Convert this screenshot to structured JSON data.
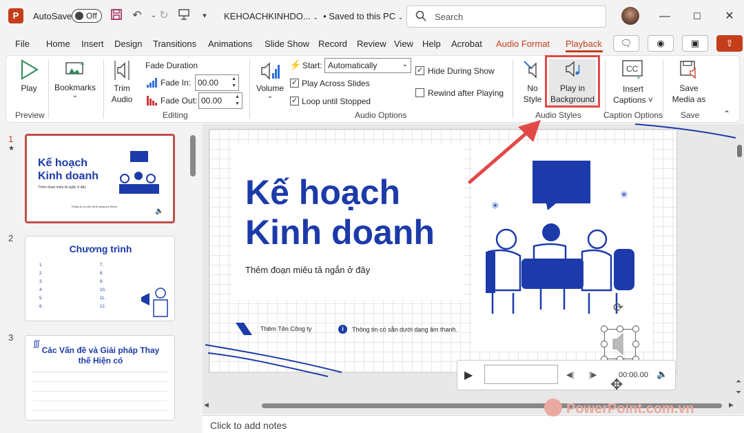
{
  "titlebar": {
    "app_badge": "P",
    "autosave_label": "AutoSave",
    "autosave_state": "Off",
    "filename": "KEHOACHKINHDO...",
    "save_status": "• Saved to this PC",
    "search_placeholder": "Search",
    "search_icon": "search-icon"
  },
  "menu": {
    "items": [
      "File",
      "Home",
      "Insert",
      "Design",
      "Transitions",
      "Animations",
      "Slide Show",
      "Record",
      "Review",
      "View",
      "Help",
      "Acrobat",
      "Audio Format",
      "Playback"
    ],
    "active": "Playback",
    "contextual": "Audio Format"
  },
  "ribbon": {
    "preview": {
      "play_label": "Play",
      "group": "Preview"
    },
    "bookmarks": {
      "label": "Bookmarks"
    },
    "editing": {
      "trim_line1": "Trim",
      "trim_line2": "Audio",
      "fade_duration": "Fade Duration",
      "fade_in_label": "Fade In:",
      "fade_in_value": "00.00",
      "fade_out_label": "Fade Out:",
      "fade_out_value": "00.00",
      "group": "Editing"
    },
    "audio_options": {
      "volume_label": "Volume",
      "start_label": "Start:",
      "start_value": "Automatically",
      "play_across_slides": "Play Across Slides",
      "play_across_checked": true,
      "loop_until_stopped": "Loop until Stopped",
      "loop_checked": true,
      "hide_during_show": "Hide During Show",
      "hide_checked": true,
      "rewind_after_playing": "Rewind after Playing",
      "rewind_checked": false,
      "group": "Audio Options"
    },
    "audio_styles": {
      "no_style_line1": "No",
      "no_style_line2": "Style",
      "play_bg_line1": "Play in",
      "play_bg_line2": "Background",
      "group": "Audio Styles"
    },
    "caption_options": {
      "insert_line1": "Insert",
      "insert_line2": "Captions ˅",
      "group": "Caption Options"
    },
    "save": {
      "line1": "Save",
      "line2": "Media as",
      "group": "Save"
    }
  },
  "thumbnails": [
    {
      "num": "1",
      "title": "Kế hoạch Kinh doanh",
      "subtitle": "Thêm đoạn miêu tả ngắn ở đây",
      "footer": "Thông tin có sẵn dưới dạng âm thanh."
    },
    {
      "num": "2",
      "title": "Chương trình",
      "items": [
        "1.",
        "2.",
        "3.",
        "4.",
        "5.",
        "6.",
        "7.",
        "8.",
        "9.",
        "10.",
        "11.",
        "12."
      ]
    },
    {
      "num": "3",
      "title": "Các Vấn đề và Giải pháp Thay thế Hiện có"
    }
  ],
  "slide": {
    "title_line1": "Kế hoạch",
    "title_line2": "Kinh doanh",
    "subtitle": "Thêm đoạn miêu tả ngắn ở đây",
    "company": "Thêm Tên Công ty",
    "info": "Thông tin có sẵn dưới dạng âm thanh.",
    "info_icon": "i"
  },
  "player": {
    "time": "00:00.00"
  },
  "notes": {
    "placeholder": "Click to add notes"
  },
  "watermark": "PowerPoint.com.vn",
  "colors": {
    "accent": "#c43e1c",
    "slide_blue": "#1c3aa9",
    "highlight": "#e34848"
  }
}
